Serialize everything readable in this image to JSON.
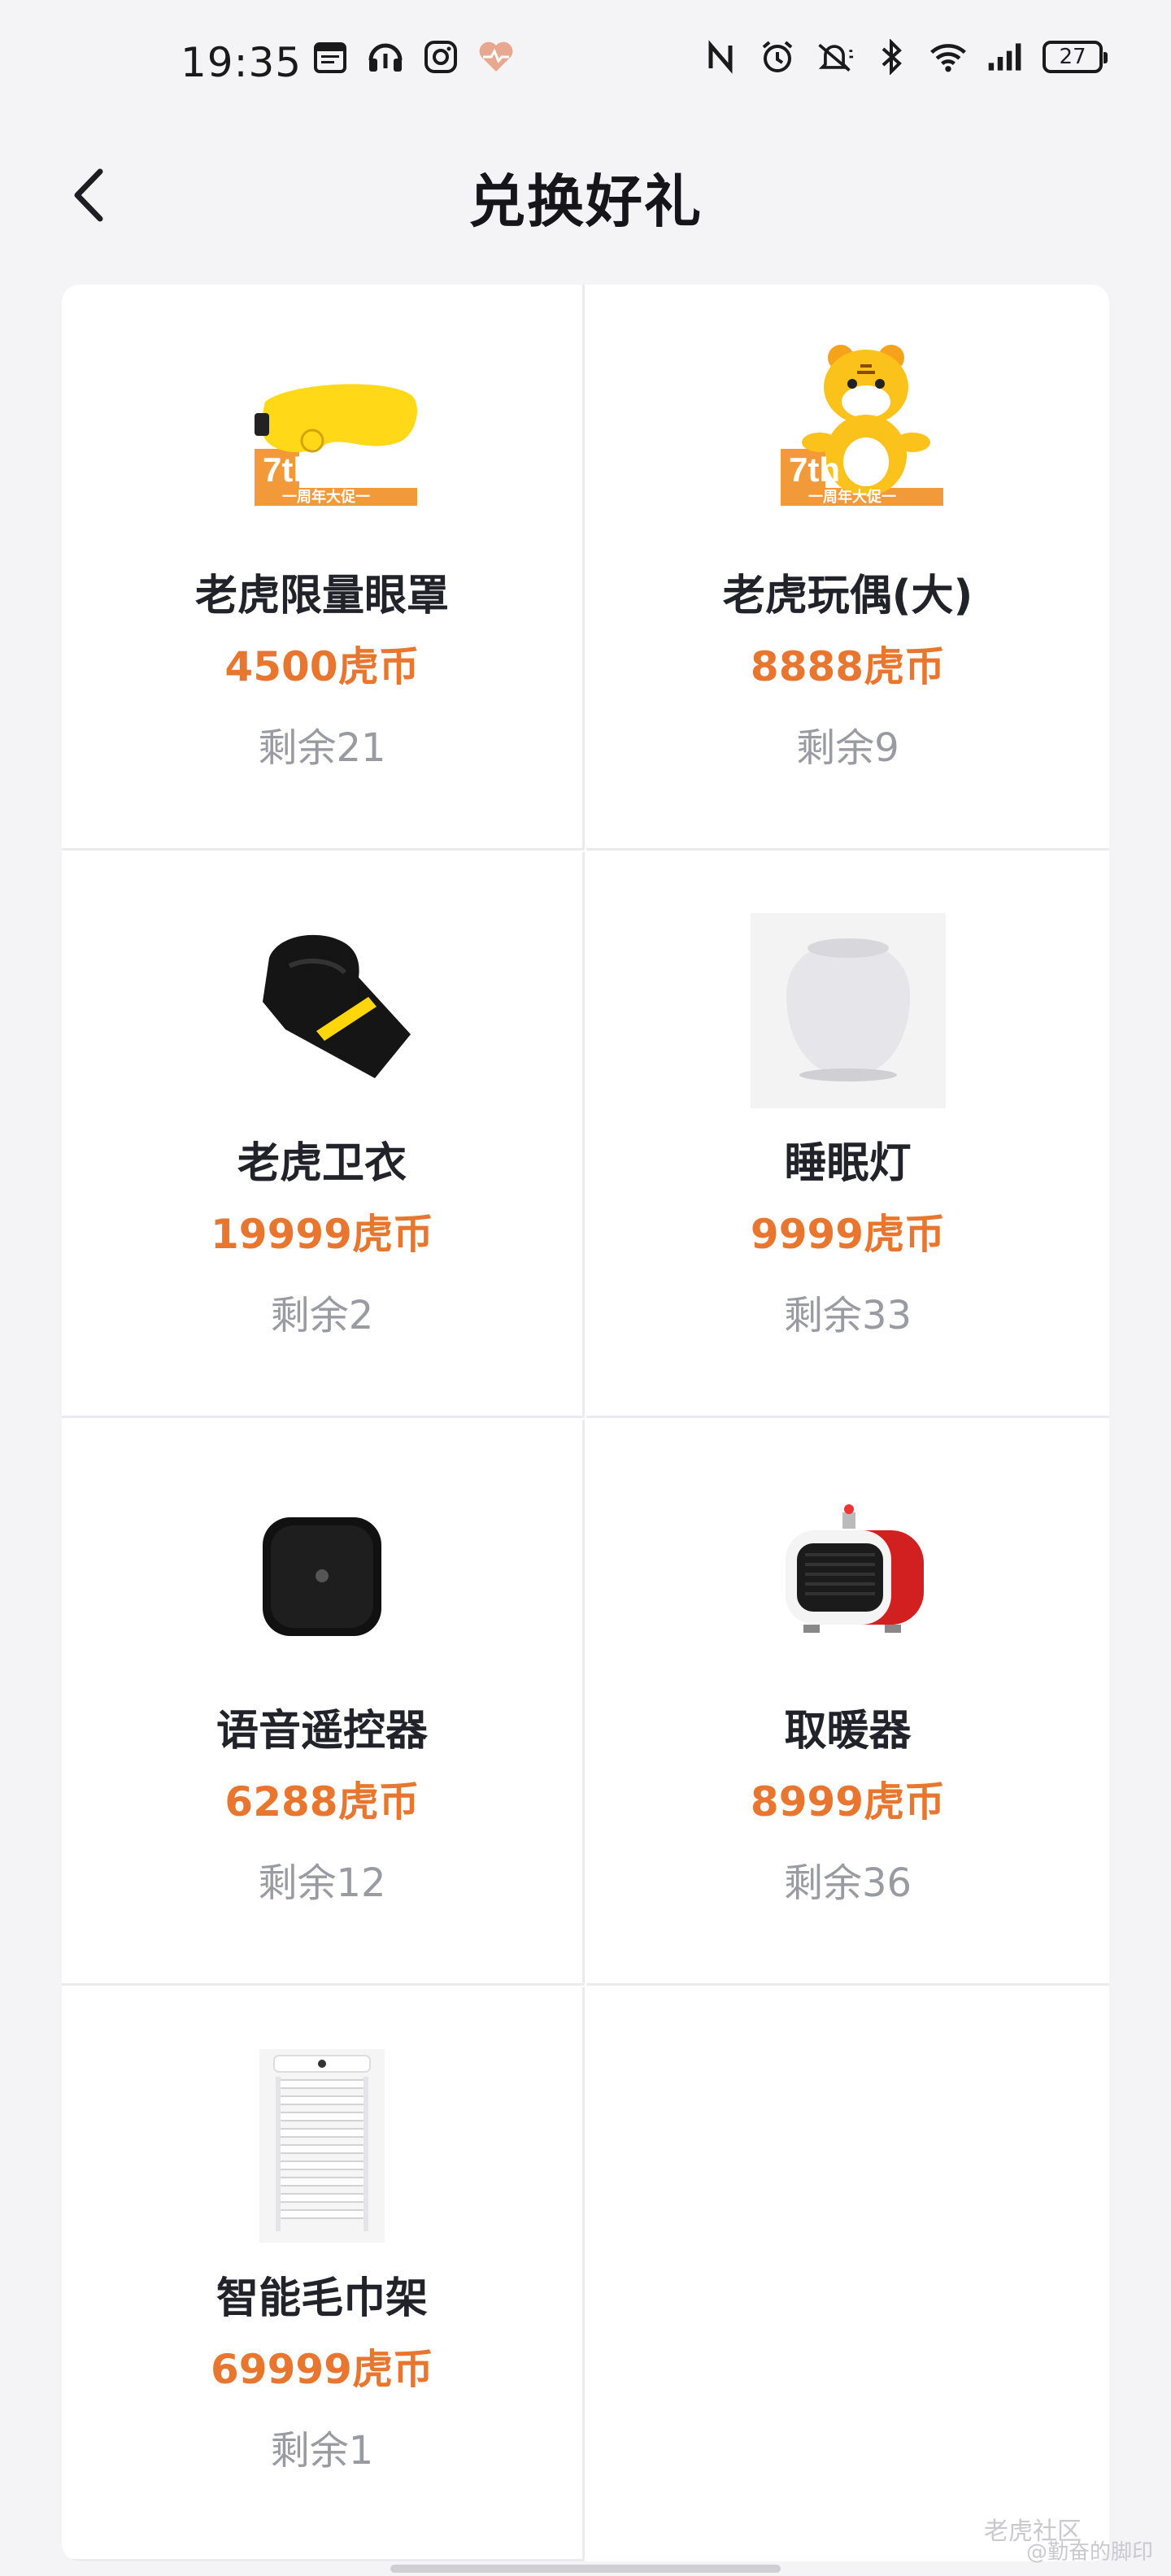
{
  "status_bar": {
    "time": "19:35",
    "battery": "27",
    "left_icons": [
      "calendar-app-icon",
      "music-app-icon",
      "instagram-icon",
      "health-icon"
    ],
    "right_icons": [
      "nfc-icon",
      "alarm-icon",
      "mute-icon",
      "bluetooth-icon",
      "wifi-icon",
      "signal-icon"
    ]
  },
  "header": {
    "title": "兑换好礼"
  },
  "colors": {
    "price": "#e9762e",
    "stock": "#9a9aa2",
    "title": "#16161a"
  },
  "items": [
    {
      "name": "老虎限量眼罩",
      "price": "4500虎币",
      "stock": "剩余21",
      "icon": "eye-mask-icon"
    },
    {
      "name": "老虎玩偶(大)",
      "price": "8888虎币",
      "stock": "剩余9",
      "icon": "tiger-doll-icon"
    },
    {
      "name": "老虎卫衣",
      "price": "19999虎币",
      "stock": "剩余2",
      "icon": "hoodie-icon"
    },
    {
      "name": "睡眠灯",
      "price": "9999虎币",
      "stock": "剩余33",
      "icon": "sleep-lamp-icon"
    },
    {
      "name": "语音遥控器",
      "price": "6288虎币",
      "stock": "剩余12",
      "icon": "voice-remote-icon"
    },
    {
      "name": "取暖器",
      "price": "8999虎币",
      "stock": "剩余36",
      "icon": "heater-icon"
    },
    {
      "name": "智能毛巾架",
      "price": "69999虎币",
      "stock": "剩余1",
      "icon": "towel-rack-icon"
    }
  ],
  "badge": {
    "line1": "7th",
    "line2": "一周年大促一"
  },
  "watermark": {
    "line1": "老虎社区",
    "line2": "@勤奋的脚印"
  }
}
